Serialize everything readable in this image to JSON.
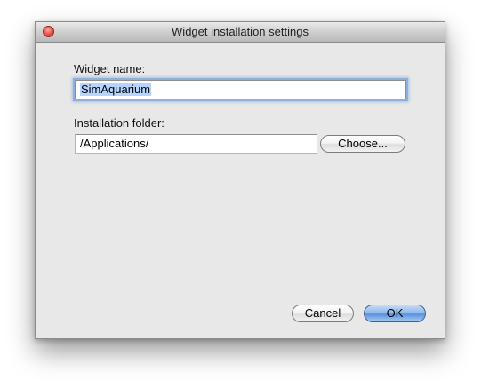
{
  "window": {
    "title": "Widget installation settings"
  },
  "form": {
    "name_label": "Widget name:",
    "name_value": "SimAquarium",
    "folder_label": "Installation folder:",
    "folder_value": "/Applications/",
    "choose_label": "Choose..."
  },
  "buttons": {
    "cancel_label": "Cancel",
    "ok_label": "OK"
  },
  "colors": {
    "window_bg": "#e8e8e8",
    "focus_ring": "#8bb1dd",
    "selection": "#b5d5ff",
    "default_button": "#5a90de"
  }
}
